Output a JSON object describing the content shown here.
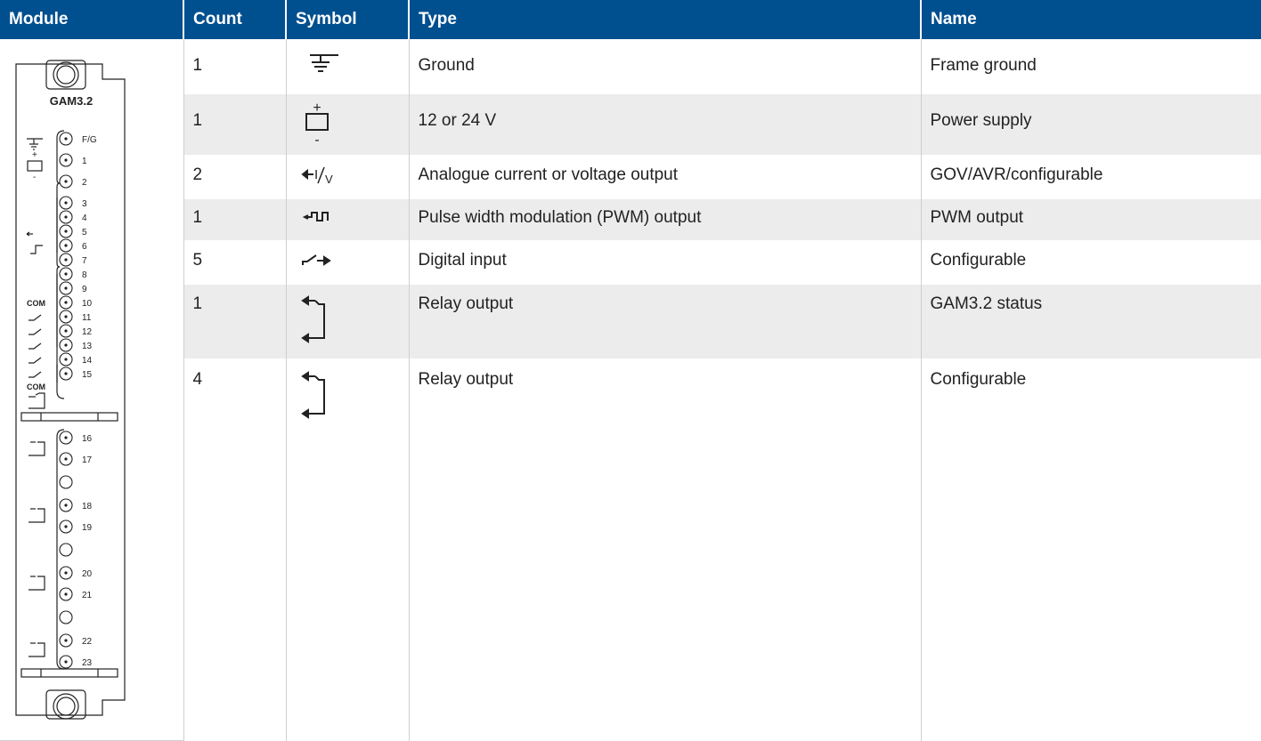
{
  "headers": [
    "Module",
    "Count",
    "Symbol",
    "Type",
    "Name"
  ],
  "module": {
    "label": "GAM3.2",
    "terminals": [
      "F/G",
      "1",
      "2",
      "3",
      "4",
      "5",
      "6",
      "7",
      "8",
      "9",
      "10",
      "11",
      "12",
      "13",
      "14",
      "15",
      "16",
      "17",
      "18",
      "19",
      "20",
      "21",
      "22",
      "23"
    ],
    "com_labels": [
      "COM",
      "COM"
    ],
    "symbol_marks": [
      "+",
      "-"
    ]
  },
  "rows": [
    {
      "count": "1",
      "symbol": "ground-symbol",
      "type": "Ground",
      "name": "Frame ground"
    },
    {
      "count": "1",
      "symbol": "battery-symbol",
      "type": "12 or 24 V",
      "name": "Power supply",
      "plus": "+",
      "minus": "-"
    },
    {
      "count": "2",
      "symbol": "analogue-output-symbol",
      "type": "Analogue current or voltage output",
      "name": "GOV/AVR/configurable",
      "glyph_i": "I",
      "glyph_v": "V"
    },
    {
      "count": "1",
      "symbol": "pwm-output-symbol",
      "type": "Pulse width modulation (PWM) output",
      "name": "PWM output"
    },
    {
      "count": "5",
      "symbol": "digital-input-symbol",
      "type": "Digital input",
      "name": "Configurable"
    },
    {
      "count": "1",
      "symbol": "relay-output-symbol",
      "type": "Relay output",
      "name": "GAM3.2 status"
    },
    {
      "count": "4",
      "symbol": "relay-output-symbol",
      "type": "Relay output",
      "name": "Configurable"
    }
  ],
  "colors": {
    "header_bg": "#004f8f",
    "header_text": "#ffffff",
    "row_shade": "#ececec",
    "border": "#cfcfcf"
  }
}
